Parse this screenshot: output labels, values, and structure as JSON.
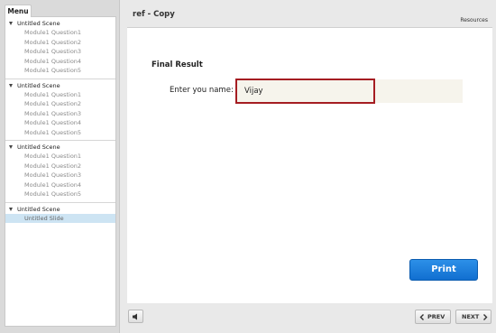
{
  "sidebar": {
    "menu_tab": "Menu",
    "scenes": [
      {
        "title": "Untitled Scene",
        "items": [
          "Module1 Question1",
          "Module1 Question2",
          "Module1 Question3",
          "Module1 Question4",
          "Module1 Question5"
        ]
      },
      {
        "title": "Untitled Scene",
        "items": [
          "Module1 Question1",
          "Module1 Question2",
          "Module1 Question3",
          "Module1 Question4",
          "Module1 Question5"
        ]
      },
      {
        "title": "Untitled Scene",
        "items": [
          "Module1 Question1",
          "Module1 Question2",
          "Module1 Question3",
          "Module1 Question4",
          "Module1 Question5"
        ]
      },
      {
        "title": "Untitled Scene",
        "items": [
          "Untitled Slide"
        ]
      }
    ]
  },
  "header": {
    "title": "ref - Copy",
    "resources": "Resources"
  },
  "main": {
    "heading": "Final Result",
    "name_label": "Enter you name:",
    "name_value": "Vijay",
    "print_label": "Print"
  },
  "footer": {
    "prev_label": "PREV",
    "next_label": "NEXT",
    "audio_icon": "speaker-icon"
  },
  "colors": {
    "accent_blue": "#1a7fdc",
    "field_border": "#a51d22",
    "active_item": "#cde4f3"
  }
}
